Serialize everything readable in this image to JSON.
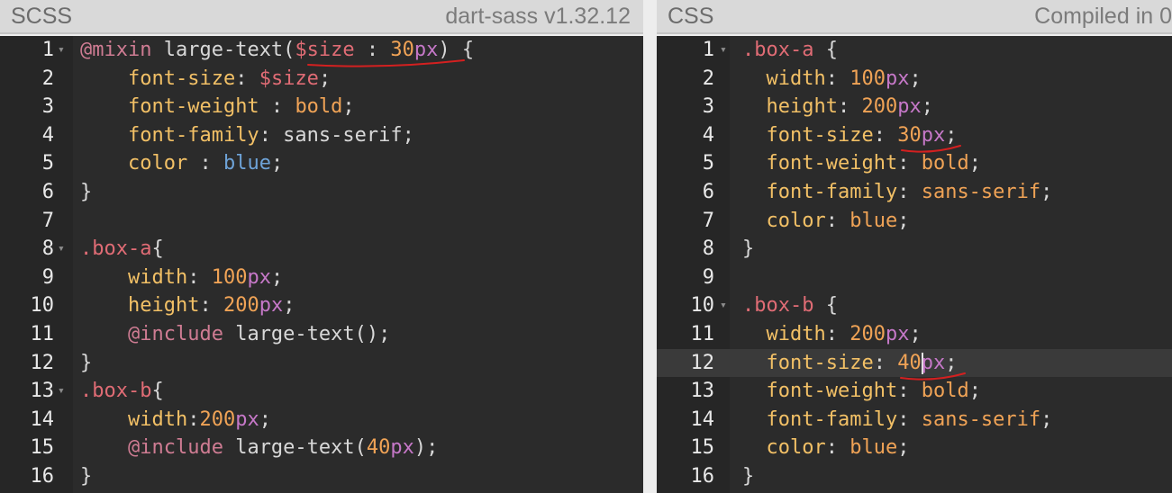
{
  "left_pane": {
    "title": "SCSS",
    "subtitle": "dart-sass v1.32.12",
    "lines": [
      {
        "n": "1",
        "fold": true,
        "tokens": [
          [
            "at",
            "@mixin"
          ],
          [
            "pun",
            " large-text("
          ],
          [
            "var",
            "$size"
          ],
          [
            "pun",
            " : "
          ],
          [
            "num",
            "30"
          ],
          [
            "unit",
            "px"
          ],
          [
            "pun",
            ") {"
          ]
        ]
      },
      {
        "n": "2",
        "tokens": [
          [
            "pun",
            "    "
          ],
          [
            "prop",
            "font-size"
          ],
          [
            "pun",
            ": "
          ],
          [
            "var",
            "$size"
          ],
          [
            "pun",
            ";"
          ]
        ]
      },
      {
        "n": "3",
        "tokens": [
          [
            "pun",
            "    "
          ],
          [
            "prop",
            "font-weight"
          ],
          [
            "pun",
            " : "
          ],
          [
            "val",
            "bold"
          ],
          [
            "pun",
            ";"
          ]
        ]
      },
      {
        "n": "4",
        "tokens": [
          [
            "pun",
            "    "
          ],
          [
            "prop",
            "font-family"
          ],
          [
            "pun",
            ": sans-serif;"
          ]
        ]
      },
      {
        "n": "5",
        "tokens": [
          [
            "pun",
            "    "
          ],
          [
            "prop",
            "color"
          ],
          [
            "pun",
            " : "
          ],
          [
            "kw",
            "blue"
          ],
          [
            "pun",
            ";"
          ]
        ]
      },
      {
        "n": "6",
        "tokens": [
          [
            "pun",
            "}"
          ]
        ]
      },
      {
        "n": "7",
        "tokens": []
      },
      {
        "n": "8",
        "fold": true,
        "tokens": [
          [
            "sel",
            ".box-a"
          ],
          [
            "pun",
            "{"
          ]
        ]
      },
      {
        "n": "9",
        "tokens": [
          [
            "pun",
            "    "
          ],
          [
            "prop",
            "width"
          ],
          [
            "pun",
            ": "
          ],
          [
            "num",
            "100"
          ],
          [
            "unit",
            "px"
          ],
          [
            "pun",
            ";"
          ]
        ]
      },
      {
        "n": "10",
        "tokens": [
          [
            "pun",
            "    "
          ],
          [
            "prop",
            "height"
          ],
          [
            "pun",
            ": "
          ],
          [
            "num",
            "200"
          ],
          [
            "unit",
            "px"
          ],
          [
            "pun",
            ";"
          ]
        ]
      },
      {
        "n": "11",
        "tokens": [
          [
            "pun",
            "    "
          ],
          [
            "at",
            "@include"
          ],
          [
            "pun",
            " large-text();"
          ]
        ]
      },
      {
        "n": "12",
        "tokens": [
          [
            "pun",
            "}"
          ]
        ]
      },
      {
        "n": "13",
        "fold": true,
        "tokens": [
          [
            "sel",
            ".box-b"
          ],
          [
            "pun",
            "{"
          ]
        ]
      },
      {
        "n": "14",
        "tokens": [
          [
            "pun",
            "    "
          ],
          [
            "prop",
            "width"
          ],
          [
            "pun",
            ":"
          ],
          [
            "num",
            "200"
          ],
          [
            "unit",
            "px"
          ],
          [
            "pun",
            ";"
          ]
        ]
      },
      {
        "n": "15",
        "tokens": [
          [
            "pun",
            "    "
          ],
          [
            "at",
            "@include"
          ],
          [
            "pun",
            " large-text("
          ],
          [
            "num",
            "40"
          ],
          [
            "unit",
            "px"
          ],
          [
            "pun",
            ");"
          ]
        ]
      },
      {
        "n": "16",
        "tokens": [
          [
            "pun",
            "}"
          ]
        ]
      }
    ]
  },
  "right_pane": {
    "title": "CSS",
    "subtitle": "Compiled in 0",
    "active_line": "12",
    "lines": [
      {
        "n": "1",
        "fold": true,
        "tokens": [
          [
            "sel",
            ".box-a"
          ],
          [
            "pun",
            " {"
          ]
        ]
      },
      {
        "n": "2",
        "tokens": [
          [
            "pun",
            "  "
          ],
          [
            "prop",
            "width"
          ],
          [
            "pun",
            ": "
          ],
          [
            "num",
            "100"
          ],
          [
            "unit",
            "px"
          ],
          [
            "pun",
            ";"
          ]
        ]
      },
      {
        "n": "3",
        "tokens": [
          [
            "pun",
            "  "
          ],
          [
            "prop",
            "height"
          ],
          [
            "pun",
            ": "
          ],
          [
            "num",
            "200"
          ],
          [
            "unit",
            "px"
          ],
          [
            "pun",
            ";"
          ]
        ]
      },
      {
        "n": "4",
        "tokens": [
          [
            "pun",
            "  "
          ],
          [
            "prop",
            "font-size"
          ],
          [
            "pun",
            ": "
          ],
          [
            "num",
            "30"
          ],
          [
            "unit",
            "px"
          ],
          [
            "pun",
            ";"
          ]
        ]
      },
      {
        "n": "5",
        "tokens": [
          [
            "pun",
            "  "
          ],
          [
            "prop",
            "font-weight"
          ],
          [
            "pun",
            ": "
          ],
          [
            "val",
            "bold"
          ],
          [
            "pun",
            ";"
          ]
        ]
      },
      {
        "n": "6",
        "tokens": [
          [
            "pun",
            "  "
          ],
          [
            "prop",
            "font-family"
          ],
          [
            "pun",
            ": "
          ],
          [
            "val",
            "sans-serif"
          ],
          [
            "pun",
            ";"
          ]
        ]
      },
      {
        "n": "7",
        "tokens": [
          [
            "pun",
            "  "
          ],
          [
            "prop",
            "color"
          ],
          [
            "pun",
            ": "
          ],
          [
            "val",
            "blue"
          ],
          [
            "pun",
            ";"
          ]
        ]
      },
      {
        "n": "8",
        "tokens": [
          [
            "pun",
            "}"
          ]
        ]
      },
      {
        "n": "9",
        "tokens": []
      },
      {
        "n": "10",
        "fold": true,
        "tokens": [
          [
            "sel",
            ".box-b"
          ],
          [
            "pun",
            " {"
          ]
        ]
      },
      {
        "n": "11",
        "tokens": [
          [
            "pun",
            "  "
          ],
          [
            "prop",
            "width"
          ],
          [
            "pun",
            ": "
          ],
          [
            "num",
            "200"
          ],
          [
            "unit",
            "px"
          ],
          [
            "pun",
            ";"
          ]
        ]
      },
      {
        "n": "12",
        "tokens": [
          [
            "pun",
            "  "
          ],
          [
            "prop",
            "font-size"
          ],
          [
            "pun",
            ": "
          ],
          [
            "num",
            "40"
          ],
          [
            "unit",
            "px"
          ],
          [
            "pun",
            ";"
          ]
        ]
      },
      {
        "n": "13",
        "tokens": [
          [
            "pun",
            "  "
          ],
          [
            "prop",
            "font-weight"
          ],
          [
            "pun",
            ": "
          ],
          [
            "val",
            "bold"
          ],
          [
            "pun",
            ";"
          ]
        ]
      },
      {
        "n": "14",
        "tokens": [
          [
            "pun",
            "  "
          ],
          [
            "prop",
            "font-family"
          ],
          [
            "pun",
            ": "
          ],
          [
            "val",
            "sans-serif"
          ],
          [
            "pun",
            ";"
          ]
        ]
      },
      {
        "n": "15",
        "tokens": [
          [
            "pun",
            "  "
          ],
          [
            "prop",
            "color"
          ],
          [
            "pun",
            ": "
          ],
          [
            "val",
            "blue"
          ],
          [
            "pun",
            ";"
          ]
        ]
      },
      {
        "n": "16",
        "tokens": [
          [
            "pun",
            "}"
          ]
        ]
      }
    ]
  },
  "icons": {
    "fold": "chevron-down-icon"
  },
  "colors": {
    "annotation": "#d42020",
    "editor_bg": "#2b2b2b",
    "header_bg": "#d9d9d9"
  }
}
